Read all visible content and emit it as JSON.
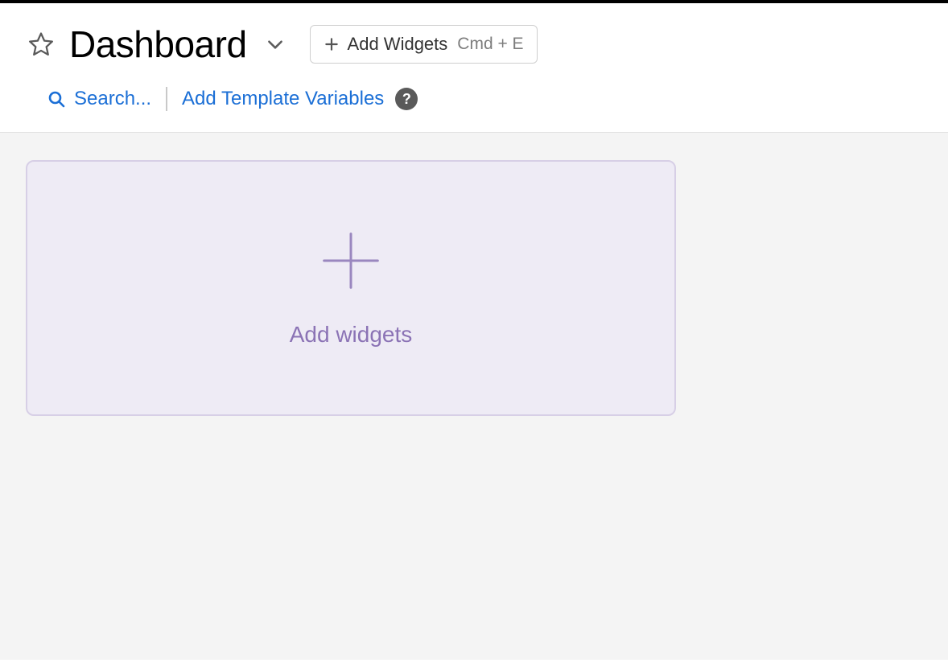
{
  "header": {
    "title": "Dashboard",
    "add_widgets_button": {
      "label": "Add Widgets",
      "shortcut": "Cmd + E"
    }
  },
  "subheader": {
    "search_placeholder": "Search...",
    "template_link": "Add Template Variables"
  },
  "empty_state": {
    "label": "Add widgets"
  },
  "colors": {
    "link": "#1b6fd6",
    "card_bg": "#eeebf5",
    "card_border": "#d7cfe6",
    "card_text": "#8b73b5"
  }
}
